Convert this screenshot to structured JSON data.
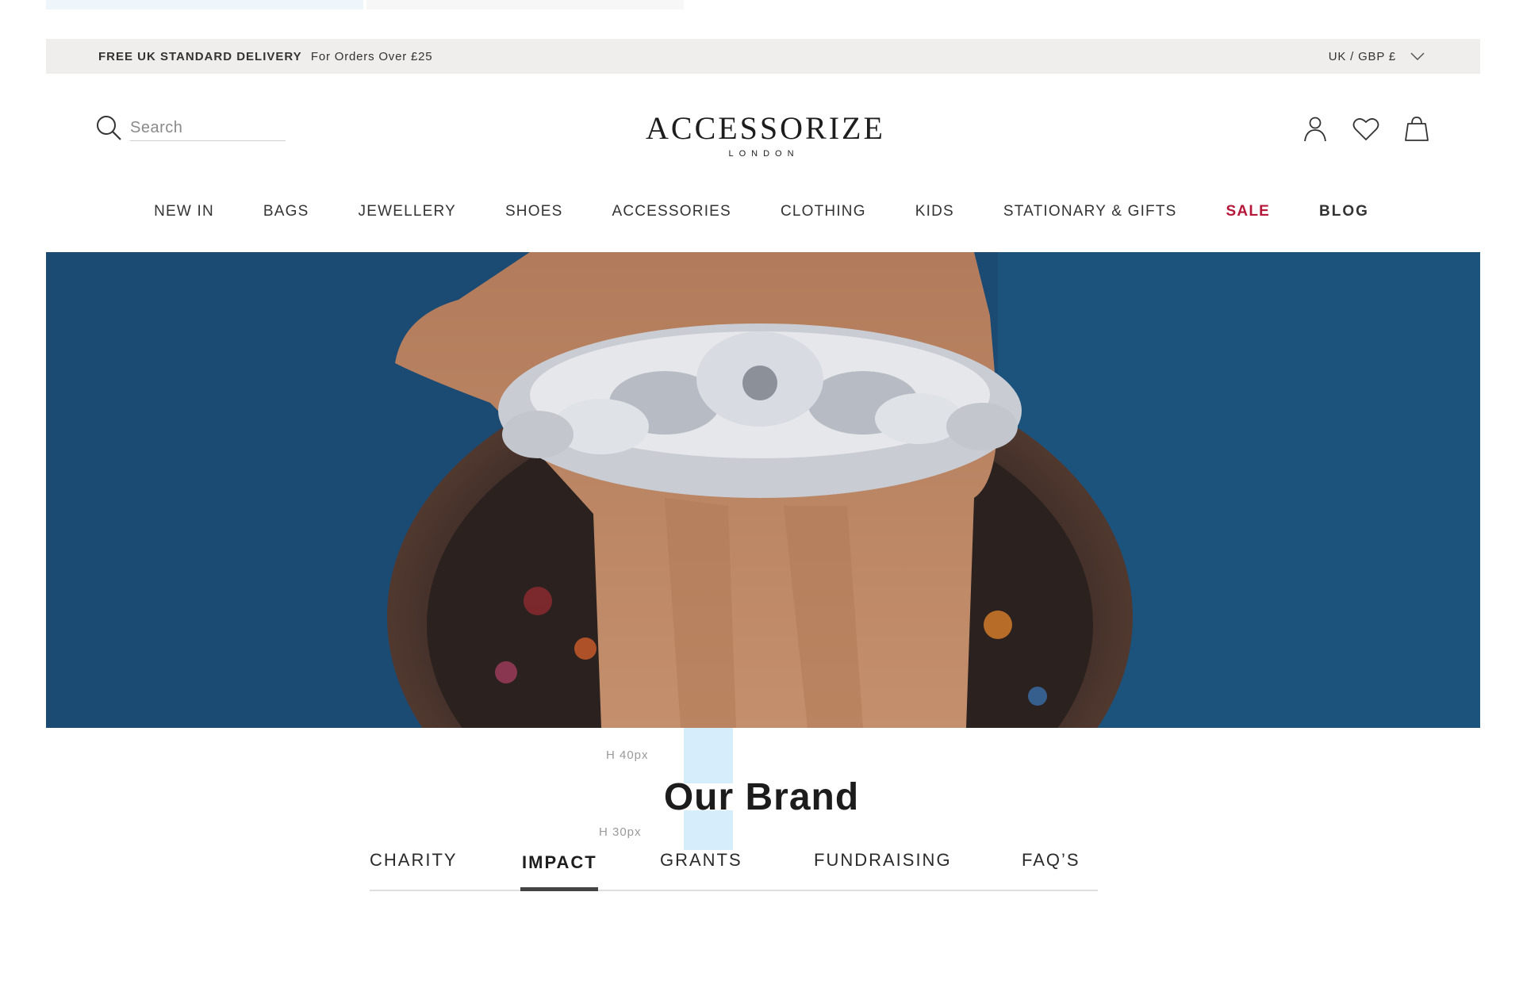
{
  "promo": {
    "bold": "FREE UK STANDARD DELIVERY",
    "light": "For Orders Over £25",
    "currency": "UK / GBP £"
  },
  "search": {
    "placeholder": "Search"
  },
  "logo": {
    "brand": "ACCESSORIZE",
    "sub": "LONDON"
  },
  "nav": {
    "items": [
      "NEW IN",
      "BAGS",
      "JEWELLERY",
      "SHOES",
      "ACCESSORIES",
      "CLOTHING",
      "KIDS",
      "STATIONARY & GIFTS",
      "SALE",
      "BLOG"
    ]
  },
  "guides": {
    "h40": "H 40px",
    "h30": "H 30px"
  },
  "section": {
    "title": "Our Brand"
  },
  "tabs": {
    "items": [
      "CHARITY",
      "IMPACT",
      "GRANTS",
      "FUNDRAISING",
      "FAQ’S"
    ],
    "active": "IMPACT"
  },
  "colors": {
    "sale": "#b5183a",
    "promo_bg": "#efeeec",
    "guide": "#d6eefb"
  }
}
